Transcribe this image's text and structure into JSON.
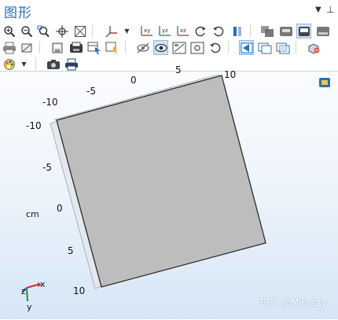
{
  "window": {
    "title": "图形",
    "pin_icon": "pin-icon",
    "menu_icon": "dropdown-arrow-icon"
  },
  "toolbar": {
    "row1": [
      "zoom-in-icon",
      "zoom-out-icon",
      "zoom-box-icon",
      "zoom-extents-icon",
      "zoom-selected-icon",
      "go-to-default-view-icon",
      "go-to-xy-view-icon",
      "go-to-yz-view-icon",
      "go-to-zx-view-icon",
      "rotate-icon",
      "reset-rotate-icon",
      "render-icon",
      "transparency-icon",
      "wireframe-icon",
      "scene-light-icon",
      "hide-icon"
    ],
    "row2": [
      "print-icon",
      "delete-selection-icon",
      "image-snapshot-icon",
      "save-icon",
      "select-object-icon",
      "select-boundary-icon",
      "hide-objects-icon",
      "show-all-icon",
      "view-icon",
      "select-domain-icon",
      "undo-view-icon",
      "select-all-icon",
      "selection-list-icon",
      "grid-icon",
      "export-icon"
    ],
    "row3": [
      "color-palette-icon",
      "camera-icon",
      "print-icon"
    ],
    "xy_label": "xy",
    "yz_label": "yz",
    "xz_label": "xz"
  },
  "graphics": {
    "top_axis_ticks": [
      "-10",
      "-5",
      "0",
      "5",
      "10"
    ],
    "left_axis_ticks": [
      "-10",
      "-5",
      "0",
      "5",
      "10"
    ],
    "unit": "cm",
    "triad": {
      "x": "x",
      "y": "y",
      "z": "z"
    },
    "watermark": "知乎 @Measay",
    "colors": {
      "background_top": "#fbfcfe",
      "background_bottom": "#d6e6f6",
      "block_fill": "#bdbdbd",
      "accent": "#2a6ebb"
    }
  }
}
